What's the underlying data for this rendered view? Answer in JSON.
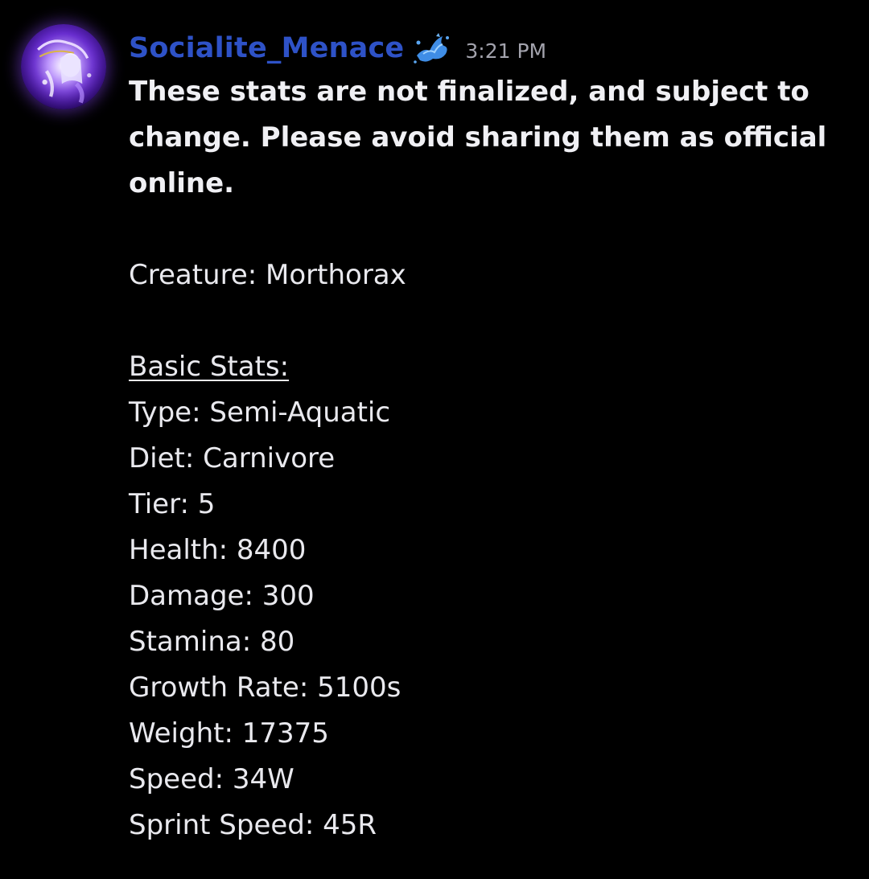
{
  "message": {
    "author": "Socialite_Menace",
    "timestamp": "3:21 PM",
    "role_icon": "blue-splash-icon",
    "avatar": "avatar-purple-character",
    "colors": {
      "username": "#2e52c7",
      "timestamp": "#a3a3ad",
      "text": "#e9e9ee",
      "background": "#000000"
    },
    "disclaimer_lines": [
      "These stats are not finalized, and subject to",
      "change. Please avoid sharing them as official",
      "online."
    ],
    "creature_line": "Creature: Morthorax",
    "basic_stats_heading": "Basic Stats:",
    "stats": [
      "Type: Semi-Aquatic",
      "Diet: Carnivore",
      "Tier: 5",
      "Health: 8400",
      "Damage: 300",
      "Stamina: 80",
      "Growth Rate: 5100s",
      "Weight: 17375",
      "Speed: 34W",
      "Sprint Speed: 45R"
    ]
  }
}
